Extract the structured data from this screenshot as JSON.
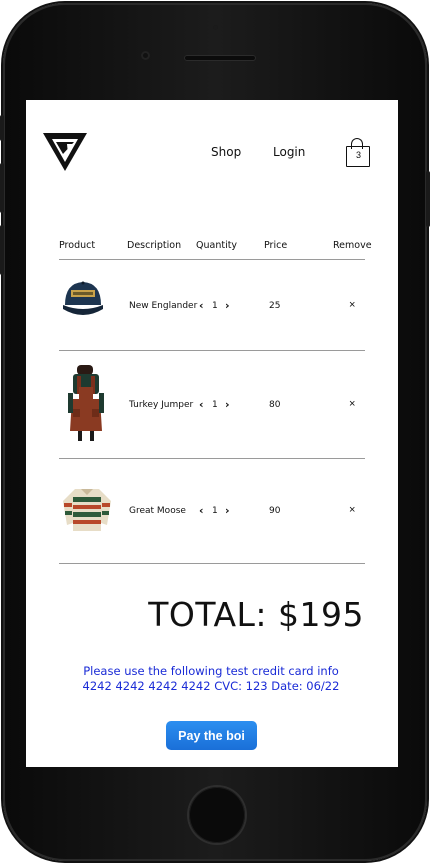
{
  "nav": {
    "shop": "Shop",
    "login": "Login",
    "cart_count": "3"
  },
  "table": {
    "headers": [
      "Product",
      "Description",
      "Quantity",
      "Price",
      "Remove"
    ],
    "rows": [
      {
        "description": "New Englander",
        "quantity": "1",
        "price": "25",
        "remove": "×",
        "image_icon": "navy-cap-image"
      },
      {
        "description": "Turkey Jumper",
        "quantity": "1",
        "price": "80",
        "remove": "×",
        "image_icon": "rust-jumper-dress-image"
      },
      {
        "description": "Great Moose",
        "quantity": "1",
        "price": "90",
        "remove": "×",
        "image_icon": "patterned-fleece-image"
      }
    ],
    "decrement": "‹",
    "increment": "›"
  },
  "total": "TOTAL: $195",
  "note": {
    "line1": "Please use the following test credit card info",
    "line2": "4242 4242 4242 4242 CVC: 123 Date: 06/22",
    "color": "#1a2bd6"
  },
  "pay_button": "Pay the boi",
  "colors": {
    "pay_button": "#1a6fd8",
    "frame": "#111111"
  }
}
